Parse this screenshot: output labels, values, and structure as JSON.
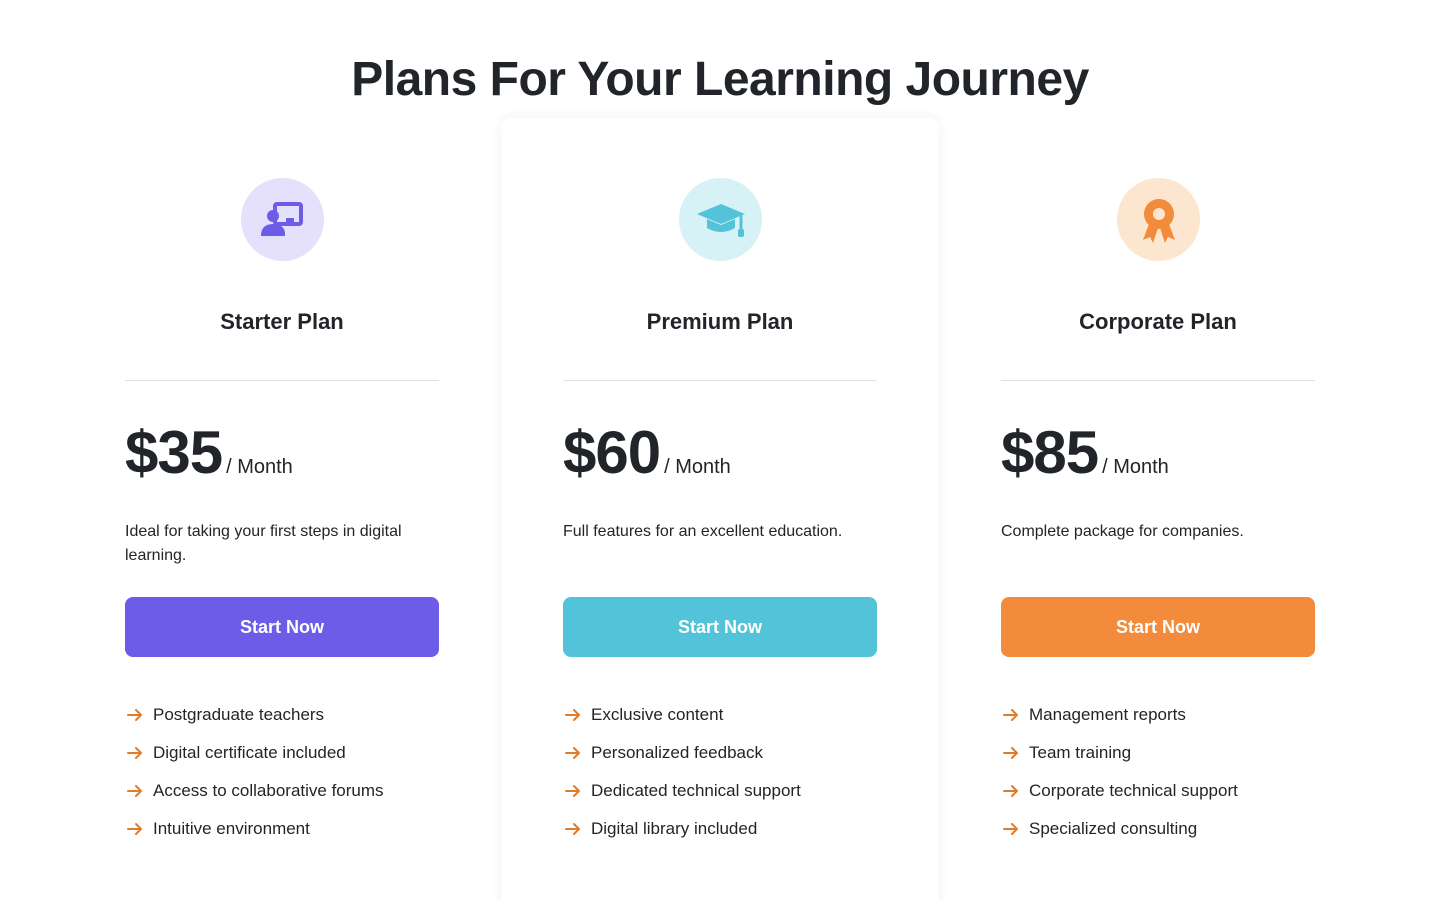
{
  "heading": "Plans For Your Learning Journey",
  "plans": [
    {
      "name": "Starter Plan",
      "price": "$35",
      "period": "/ Month",
      "description": "Ideal for taking your first steps in digital learning.",
      "cta": "Start Now",
      "icon": "chalkboard-teacher-icon",
      "accent": "#6c5ce7",
      "icon_bg": "#e5e0fb",
      "features": [
        "Postgraduate teachers",
        "Digital certificate included",
        "Access to collaborative forums",
        "Intuitive environment"
      ]
    },
    {
      "name": "Premium Plan",
      "price": "$60",
      "period": "/ Month",
      "description": "Full features for an excellent education.",
      "cta": "Start Now",
      "icon": "graduation-cap-icon",
      "accent": "#52c3d9",
      "icon_bg": "#d6f2f6",
      "features": [
        "Exclusive content",
        "Personalized feedback",
        "Dedicated technical support",
        "Digital library included"
      ]
    },
    {
      "name": "Corporate Plan",
      "price": "$85",
      "period": "/ Month",
      "description": "Complete package for companies.",
      "cta": "Start Now",
      "icon": "award-ribbon-icon",
      "accent": "#f28b3b",
      "icon_bg": "#fde6d0",
      "features": [
        "Management reports",
        "Team training",
        "Corporate technical support",
        "Specialized consulting"
      ]
    }
  ],
  "feature_arrow_color": "#e07b2a"
}
